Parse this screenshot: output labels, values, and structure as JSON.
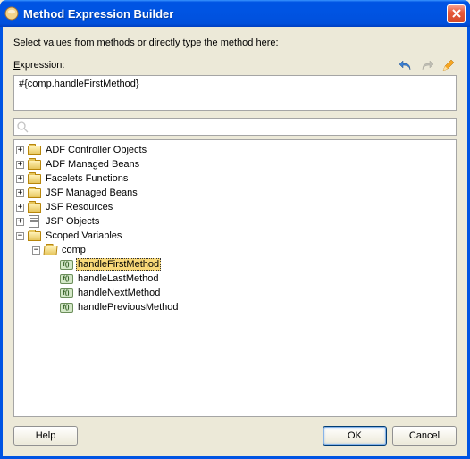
{
  "window": {
    "title": "Method Expression Builder"
  },
  "instruction": "Select values from methods or directly type the method here:",
  "expression": {
    "label": "Expression:",
    "value": "#{comp.handleFirstMethod}"
  },
  "toolbar": {
    "undo": "undo-icon",
    "redo": "redo-icon",
    "edit": "pencil-icon"
  },
  "search": {
    "placeholder": ""
  },
  "tree": {
    "nodes": [
      {
        "label": "ADF Controller Objects",
        "icon": "folder",
        "expandable": true,
        "expanded": false,
        "level": 0
      },
      {
        "label": "ADF Managed Beans",
        "icon": "folder",
        "expandable": true,
        "expanded": false,
        "level": 0
      },
      {
        "label": "Facelets Functions",
        "icon": "folder",
        "expandable": true,
        "expanded": false,
        "level": 0
      },
      {
        "label": "JSF Managed Beans",
        "icon": "folder",
        "expandable": true,
        "expanded": false,
        "level": 0
      },
      {
        "label": "JSF Resources",
        "icon": "folder",
        "expandable": true,
        "expanded": false,
        "level": 0
      },
      {
        "label": "JSP Objects",
        "icon": "page",
        "expandable": true,
        "expanded": false,
        "level": 0
      },
      {
        "label": "Scoped Variables",
        "icon": "folder",
        "expandable": true,
        "expanded": true,
        "level": 0
      },
      {
        "label": "comp",
        "icon": "folder-open",
        "expandable": true,
        "expanded": true,
        "level": 1
      },
      {
        "label": "handleFirstMethod",
        "icon": "method",
        "expandable": false,
        "expanded": false,
        "level": 2,
        "selected": true
      },
      {
        "label": "handleLastMethod",
        "icon": "method",
        "expandable": false,
        "expanded": false,
        "level": 2
      },
      {
        "label": "handleNextMethod",
        "icon": "method",
        "expandable": false,
        "expanded": false,
        "level": 2
      },
      {
        "label": "handlePreviousMethod",
        "icon": "method",
        "expandable": false,
        "expanded": false,
        "level": 2
      }
    ]
  },
  "buttons": {
    "help": "Help",
    "ok": "OK",
    "cancel": "Cancel"
  }
}
